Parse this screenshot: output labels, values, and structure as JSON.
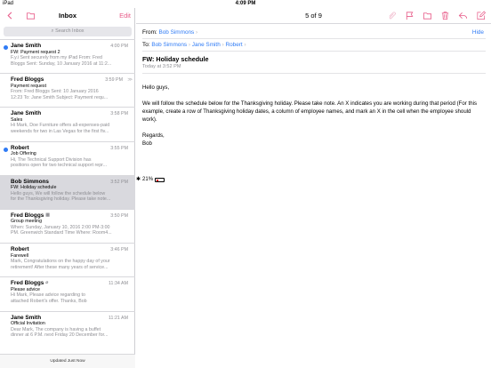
{
  "status": {
    "carrier": "iPad",
    "time": "4:09 PM",
    "battery": "21%"
  },
  "left": {
    "title": "Inbox",
    "edit": "Edit",
    "search_placeholder": "Search Inbox",
    "footer": "Updated Just Now",
    "messages": [
      {
        "name": "Jane Smith",
        "date": "4:00 PM",
        "subject": "FW: Payment request 2",
        "preview1": "F.y.i Sent securely from my iPad From: Fred",
        "preview2": "Bloggs Sent: Sunday, 10 January 2016 at 11:2...",
        "unread": true
      },
      {
        "name": "Fred Bloggs",
        "date": "3:59 PM",
        "subject": "Payment request",
        "preview1": "From: Fred Bloggs Sent: 10 January 2016",
        "preview2": "12:23 To: Jane Smith Subject: Payment requ...",
        "unread": false
      },
      {
        "name": "Jane Smith",
        "date": "3:58 PM",
        "subject": "Sales",
        "preview1": "Hi Mark, Doe Furniture offers all-expenses-paid",
        "preview2": "weekends for two in Las Vegas for the first fiv...",
        "unread": false
      },
      {
        "name": "Robert",
        "date": "3:55 PM",
        "subject": "Job Offering",
        "preview1": "Hi, The Technical Support Division has",
        "preview2": "positions open for two technical support repr...",
        "unread": true
      },
      {
        "name": "Bob Simmons",
        "date": "3:52 PM",
        "subject": "FW: Holiday schedule",
        "preview1": "Hello guys, We will follow the schedule below",
        "preview2": "for the Thanksgiving holiday. Please take note...",
        "unread": false
      },
      {
        "name": "Fred Bloggs",
        "date": "3:50 PM",
        "subject": "Group meeting",
        "preview1": "When: Sunday, January 10, 2016 2:00 PM-3:00",
        "preview2": "PM. Greenwich Standard Time Where: Room4...",
        "unread": false
      },
      {
        "name": "Robert",
        "date": "3:46 PM",
        "subject": "Farewell",
        "preview1": "Mark, Congratulations on the happy day of your",
        "preview2": "retirement! After these many years of service...",
        "unread": false
      },
      {
        "name": "Fred Bloggs",
        "date": "11:34 AM",
        "subject": "Please advice",
        "preview1": "Hi Mark, Please advice regarding to",
        "preview2": "attached Robert's offer. Thanks, Bob",
        "unread": false
      },
      {
        "name": "Jane Smith",
        "date": "11:21 AM",
        "subject": "Official Invitation",
        "preview1": "Dear Mark, The company is having a buffet",
        "preview2": "dinner at 6 P.M. next Friday 20 December for...",
        "unread": false
      }
    ]
  },
  "right": {
    "counter": "5 of 9",
    "from_label": "From:",
    "from": "Bob Simmons",
    "hide": "Hide",
    "to_label": "To:",
    "to": [
      "Bob Simmons",
      "Jane Smith",
      "Robert"
    ],
    "subject": "FW: Holiday schedule",
    "when": "Today at 3:52 PM",
    "body": {
      "greeting": "Hello guys,",
      "paragraph": "We will follow the schedule below for the Thanksgiving holiday. Please take note. An X indicates you are working during that period (For this example, create a row of Thanksgiving holiday dates, a column of employee names, and mark an X in the cell when the employee should work).",
      "regards": "Regards,",
      "signature": "Bob"
    }
  },
  "colors": {
    "accent": "#e85d8a",
    "link": "#2f7bf5",
    "unread_dot": "#2f7bf5",
    "selected_row": "#d9d9de"
  }
}
